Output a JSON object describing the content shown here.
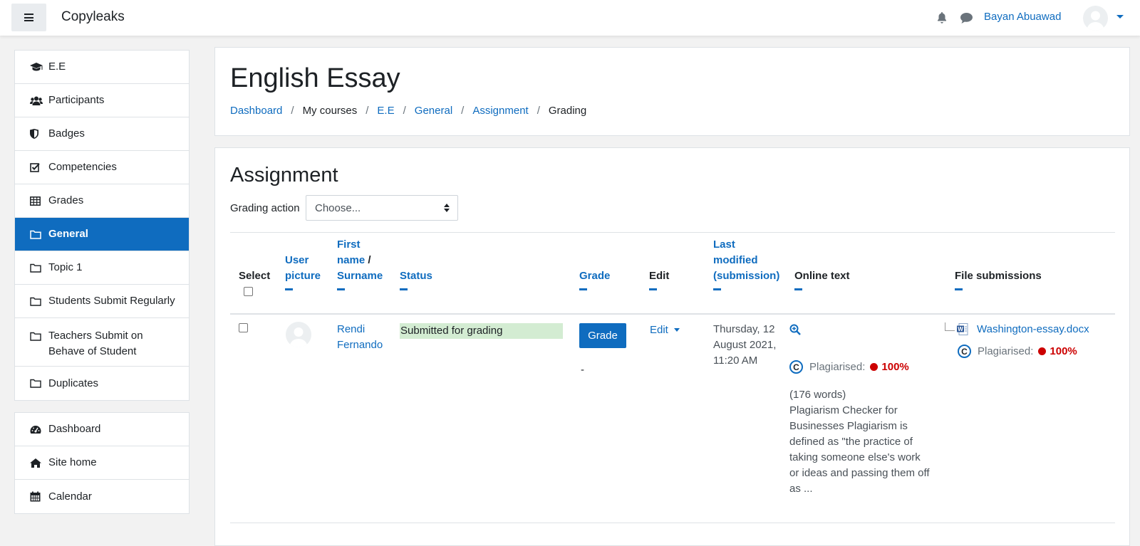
{
  "navbar": {
    "brand": "Copyleaks",
    "username": "Bayan Abuawad"
  },
  "sidebar": {
    "course_items": [
      {
        "label": "E.E",
        "icon": "graduation-cap-icon"
      },
      {
        "label": "Participants",
        "icon": "users-icon"
      },
      {
        "label": "Badges",
        "icon": "shield-icon"
      },
      {
        "label": "Competencies",
        "icon": "check-square-icon"
      },
      {
        "label": "Grades",
        "icon": "table-icon"
      },
      {
        "label": "General",
        "icon": "folder-icon",
        "active": true
      },
      {
        "label": "Topic 1",
        "icon": "folder-icon"
      },
      {
        "label": "Students Submit Regularly",
        "icon": "folder-icon"
      },
      {
        "label": "Teachers Submit on Behave of Student",
        "icon": "folder-icon"
      },
      {
        "label": "Duplicates",
        "icon": "folder-icon"
      }
    ],
    "site_items": [
      {
        "label": "Dashboard",
        "icon": "tachometer-icon"
      },
      {
        "label": "Site home",
        "icon": "home-icon"
      },
      {
        "label": "Calendar",
        "icon": "calendar-icon"
      }
    ]
  },
  "header": {
    "title": "English Essay",
    "breadcrumb": [
      "Dashboard",
      "My courses",
      "E.E",
      "General",
      "Assignment",
      "Grading"
    ]
  },
  "assignment": {
    "title": "Assignment",
    "grading_action_label": "Grading action",
    "grading_action_value": "Choose...",
    "columns": {
      "select": "Select",
      "user_picture_1": "User",
      "user_picture_2": "picture",
      "first_name_1": "First",
      "first_name_2": "name",
      "surname": "Surname",
      "status": "Status",
      "grade": "Grade",
      "edit": "Edit",
      "last_modified_1": "Last",
      "last_modified_2": "modified",
      "last_modified_3": "(submission)",
      "online_text": "Online text",
      "file_submissions": "File submissions"
    },
    "row": {
      "first_name": "Rendi",
      "surname": "Fernando",
      "status": "Submitted for grading",
      "grade_button": "Grade",
      "grade_value": "-",
      "edit": "Edit",
      "last_modified_1": "Thursday, 12",
      "last_modified_2": "August 2021,",
      "last_modified_3": "11:20 AM",
      "plagiarised_label": "Plagiarised:",
      "plagiarised_pct": "100%",
      "word_count": "(176 words)",
      "excerpt": "Plagiarism Checker for Businesses Plagiarism is defined as \"the practice of taking someone else's work or ideas and passing them off as ...",
      "file_name": "Washington-essay.docx",
      "file_plagiarised_label": "Plagiarised:",
      "file_plagiarised_pct": "100%"
    }
  },
  "colors": {
    "primary": "#0f6cbf",
    "status_bg": "#d3ecd2",
    "plagiarism_red": "#cc0000"
  }
}
